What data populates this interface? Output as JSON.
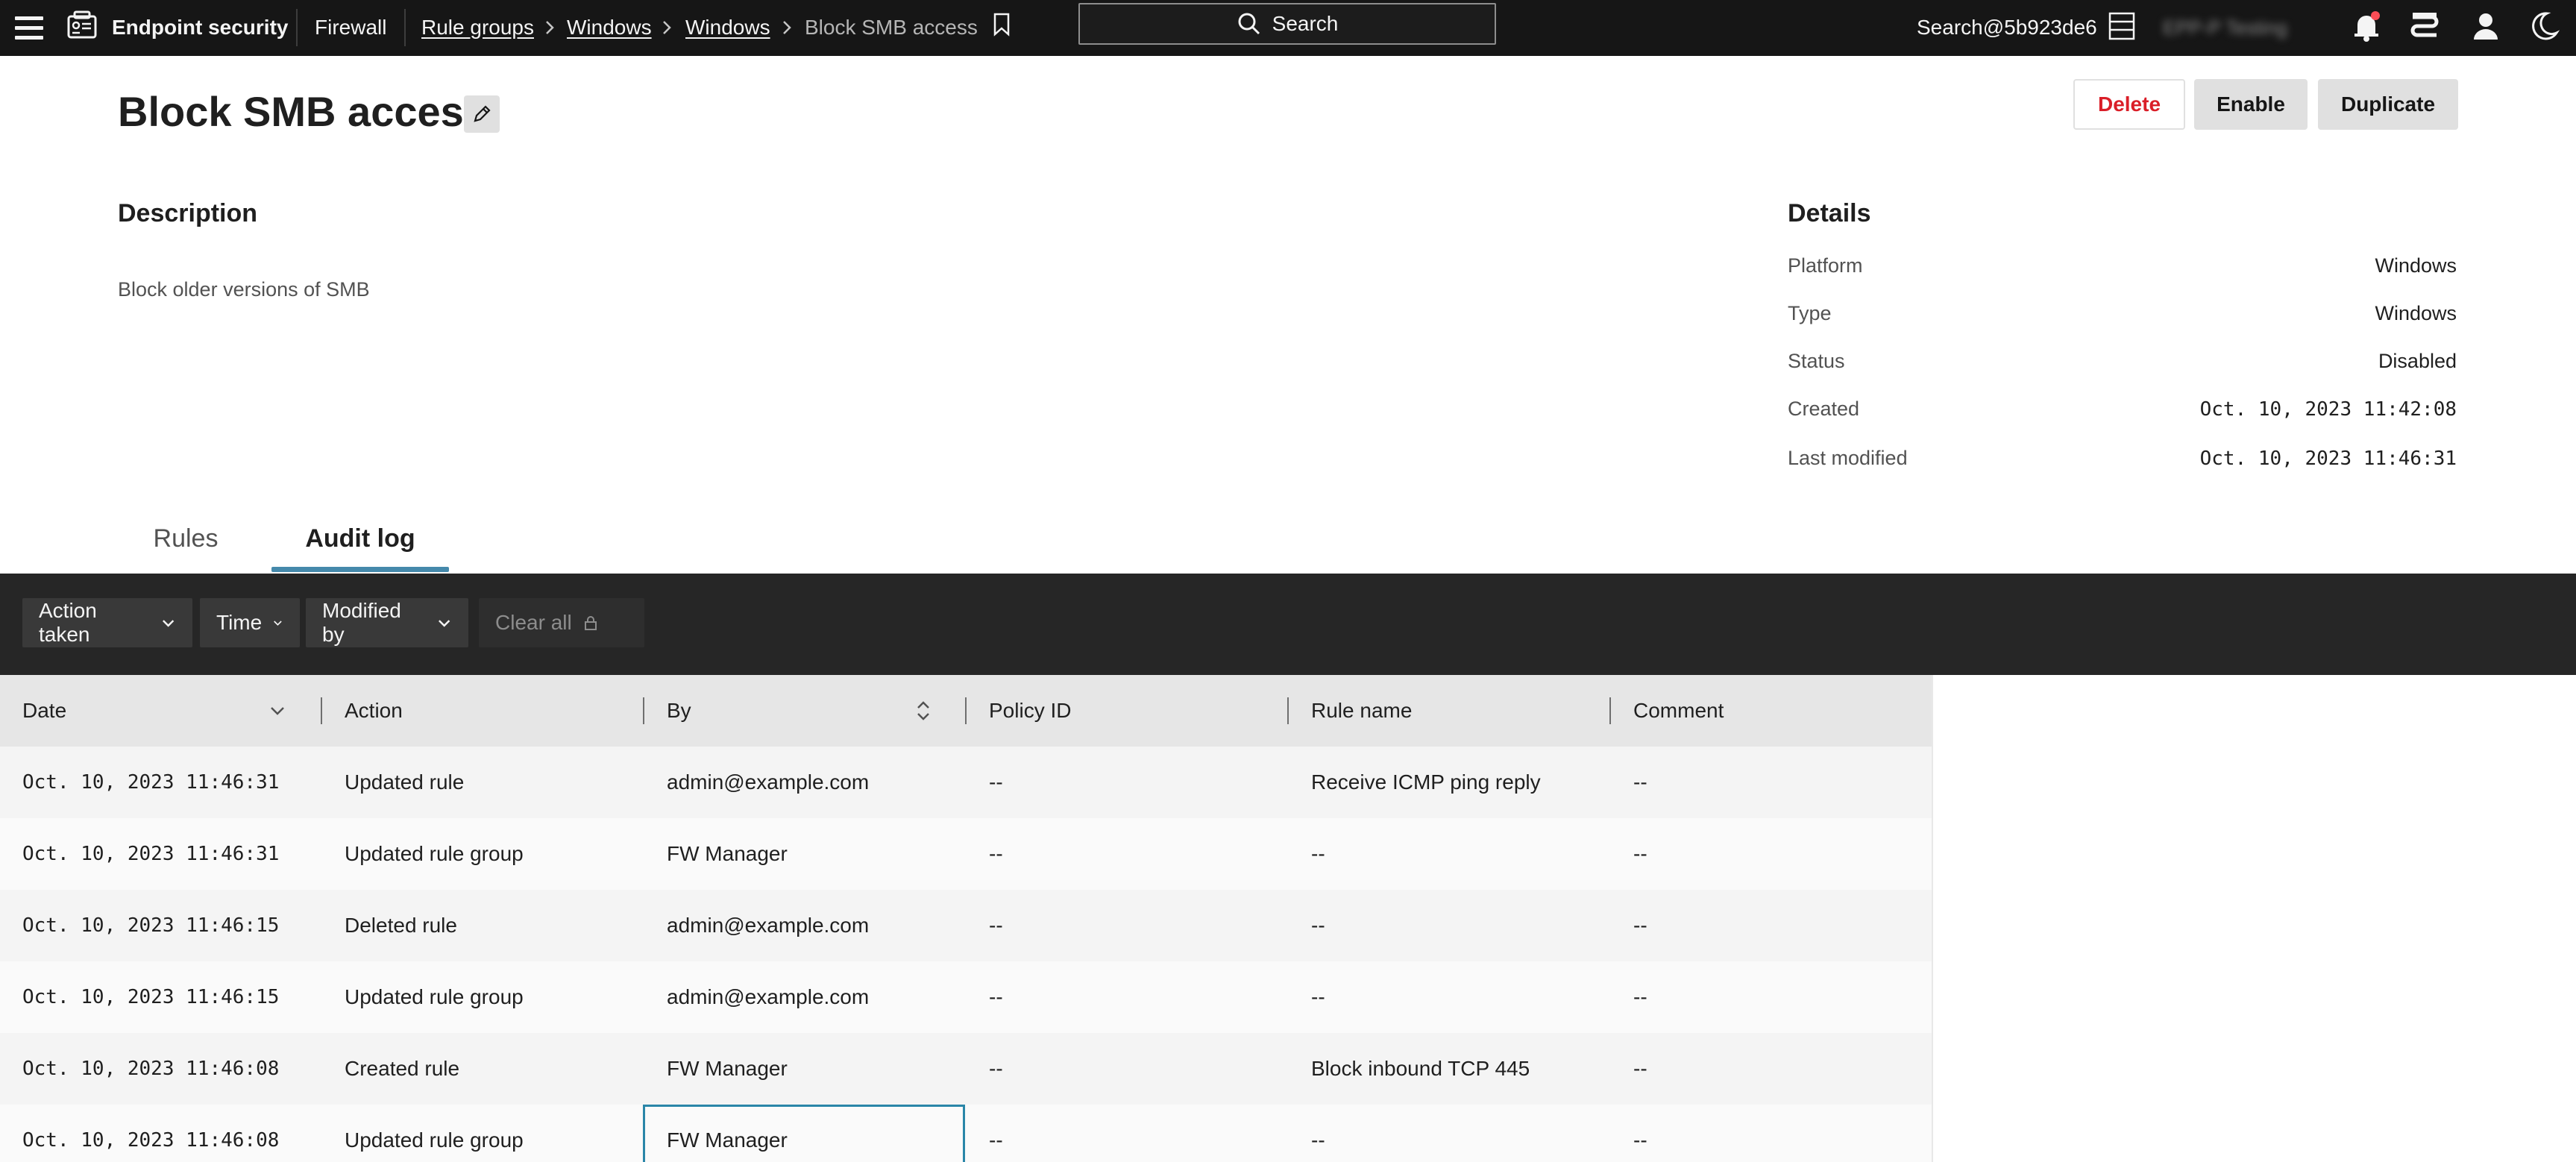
{
  "topbar": {
    "app_title": "Endpoint security",
    "breadcrumbs": [
      {
        "label": "Firewall",
        "link": false
      },
      {
        "label": "Rule groups",
        "link": true
      },
      {
        "label": "Windows",
        "link": true
      },
      {
        "label": "Windows",
        "link": true
      },
      {
        "label": "Block SMB access",
        "link": false
      }
    ],
    "search_label": "Search",
    "user": "Search@5b923de6",
    "tenant": "EPP-P Testing",
    "icons": [
      "menu-icon",
      "endpoint-app-icon",
      "bookmark-icon",
      "search-icon",
      "server-icon",
      "bell-icon",
      "support-icon",
      "user-icon",
      "moon-icon"
    ],
    "notification_dot_color": "#fa4d56"
  },
  "page": {
    "title": "Block SMB access",
    "buttons": {
      "delete": "Delete",
      "enable": "Enable",
      "duplicate": "Duplicate"
    }
  },
  "description": {
    "heading": "Description",
    "text": "Block older versions of SMB"
  },
  "details": {
    "heading": "Details",
    "rows": [
      {
        "label": "Platform",
        "value": "Windows"
      },
      {
        "label": "Type",
        "value": "Windows"
      },
      {
        "label": "Status",
        "value": "Disabled"
      },
      {
        "label": "Created",
        "value": "Oct. 10, 2023 11:42:08"
      },
      {
        "label": "Last modified",
        "value": "Oct. 10, 2023 11:46:31"
      }
    ]
  },
  "tabs": [
    {
      "label": "Rules",
      "active": false
    },
    {
      "label": "Audit log",
      "active": true
    }
  ],
  "filters": {
    "action_taken": "Action taken",
    "time": "Time",
    "modified_by": "Modified by",
    "clear_all": "Clear all"
  },
  "table": {
    "columns": [
      "Date",
      "Action",
      "By",
      "Policy ID",
      "Rule name",
      "Comment"
    ],
    "rows": [
      [
        "Oct. 10, 2023 11:46:31",
        "Updated rule",
        "admin@example.com",
        "--",
        "Receive ICMP ping reply",
        "--"
      ],
      [
        "Oct. 10, 2023 11:46:31",
        "Updated rule group",
        "FW Manager",
        "--",
        "--",
        "--"
      ],
      [
        "Oct. 10, 2023 11:46:15",
        "Deleted rule",
        "admin@example.com",
        "--",
        "--",
        "--"
      ],
      [
        "Oct. 10, 2023 11:46:15",
        "Updated rule group",
        "admin@example.com",
        "--",
        "--",
        "--"
      ],
      [
        "Oct. 10, 2023 11:46:08",
        "Created rule",
        "FW Manager",
        "--",
        "Block inbound TCP 445",
        "--"
      ],
      [
        "Oct. 10, 2023 11:46:08",
        "Updated rule group",
        "FW Manager",
        "--",
        "--",
        "--"
      ]
    ]
  },
  "colors": {
    "topbar_bg": "#161616",
    "filterbar_bg": "#262626",
    "tab_accent": "#4589ab",
    "delete_red": "#da1e28",
    "focus_border": "#2a86a8"
  }
}
